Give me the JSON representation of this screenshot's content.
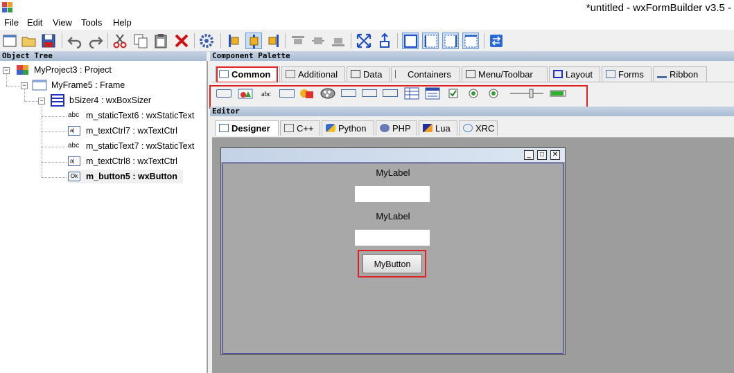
{
  "window": {
    "title": "*untitled - wxFormBuilder v3.5 -"
  },
  "menu": {
    "items": [
      "File",
      "Edit",
      "View",
      "Tools",
      "Help"
    ]
  },
  "toolbar": {
    "buttons": [
      "new-icon",
      "open-icon",
      "save-icon",
      "undo-icon",
      "redo-icon",
      "cut-icon",
      "copy-icon",
      "paste-icon",
      "delete-icon",
      "generate-code-icon",
      "align-left-icon",
      "align-center-icon",
      "align-right-icon",
      "align-top-icon",
      "align-middle-icon",
      "align-bottom-icon",
      "expand-icon",
      "stretch-icon",
      "border-all-icon",
      "border-left-icon",
      "border-right-icon",
      "border-top-icon",
      "swap-icon"
    ]
  },
  "object_tree": {
    "header": "Object Tree",
    "items": [
      {
        "label": "MyProject3 : Project"
      },
      {
        "label": "MyFrame5 : Frame"
      },
      {
        "label": "bSizer4 : wxBoxSizer"
      },
      {
        "label": "m_staticText6 : wxStaticText"
      },
      {
        "label": "m_textCtrl7 : wxTextCtrl"
      },
      {
        "label": "m_staticText7 : wxStaticText"
      },
      {
        "label": "m_textCtrl8 : wxTextCtrl"
      },
      {
        "label": "m_button5 : wxButton"
      }
    ],
    "icon_texts": {
      "ok": "Ok",
      "abc": "abc",
      "textctrl": "a|"
    }
  },
  "palette": {
    "header": "Component Palette",
    "tabs": [
      "Common",
      "Additional",
      "Data",
      "Containers",
      "Menu/Toolbar",
      "Layout",
      "Forms",
      "Ribbon"
    ],
    "selected_tab": "Common",
    "items": [
      "button-icon",
      "bitmap-button-icon",
      "static-text-icon",
      "text-ctrl-icon",
      "combo-box-icon",
      "choice-icon",
      "list-box-icon",
      "spin-ctrl-icon",
      "bitmap-combo-icon",
      "grid-icon",
      "list-ctrl-icon",
      "check-box-icon",
      "radio-box-icon",
      "radio-button-icon",
      "slider-icon",
      "gauge-icon"
    ]
  },
  "editor": {
    "header": "Editor",
    "tabs": [
      "Designer",
      "C++",
      "Python",
      "PHP",
      "Lua",
      "XRC"
    ],
    "selected_tab": "Designer",
    "form": {
      "label1": "MyLabel",
      "label2": "MyLabel",
      "button": "MyButton"
    }
  },
  "colors": {
    "highlight": "#e02020",
    "editor_bg": "#9d9d9d",
    "frame_bg": "#a8a8a8"
  }
}
